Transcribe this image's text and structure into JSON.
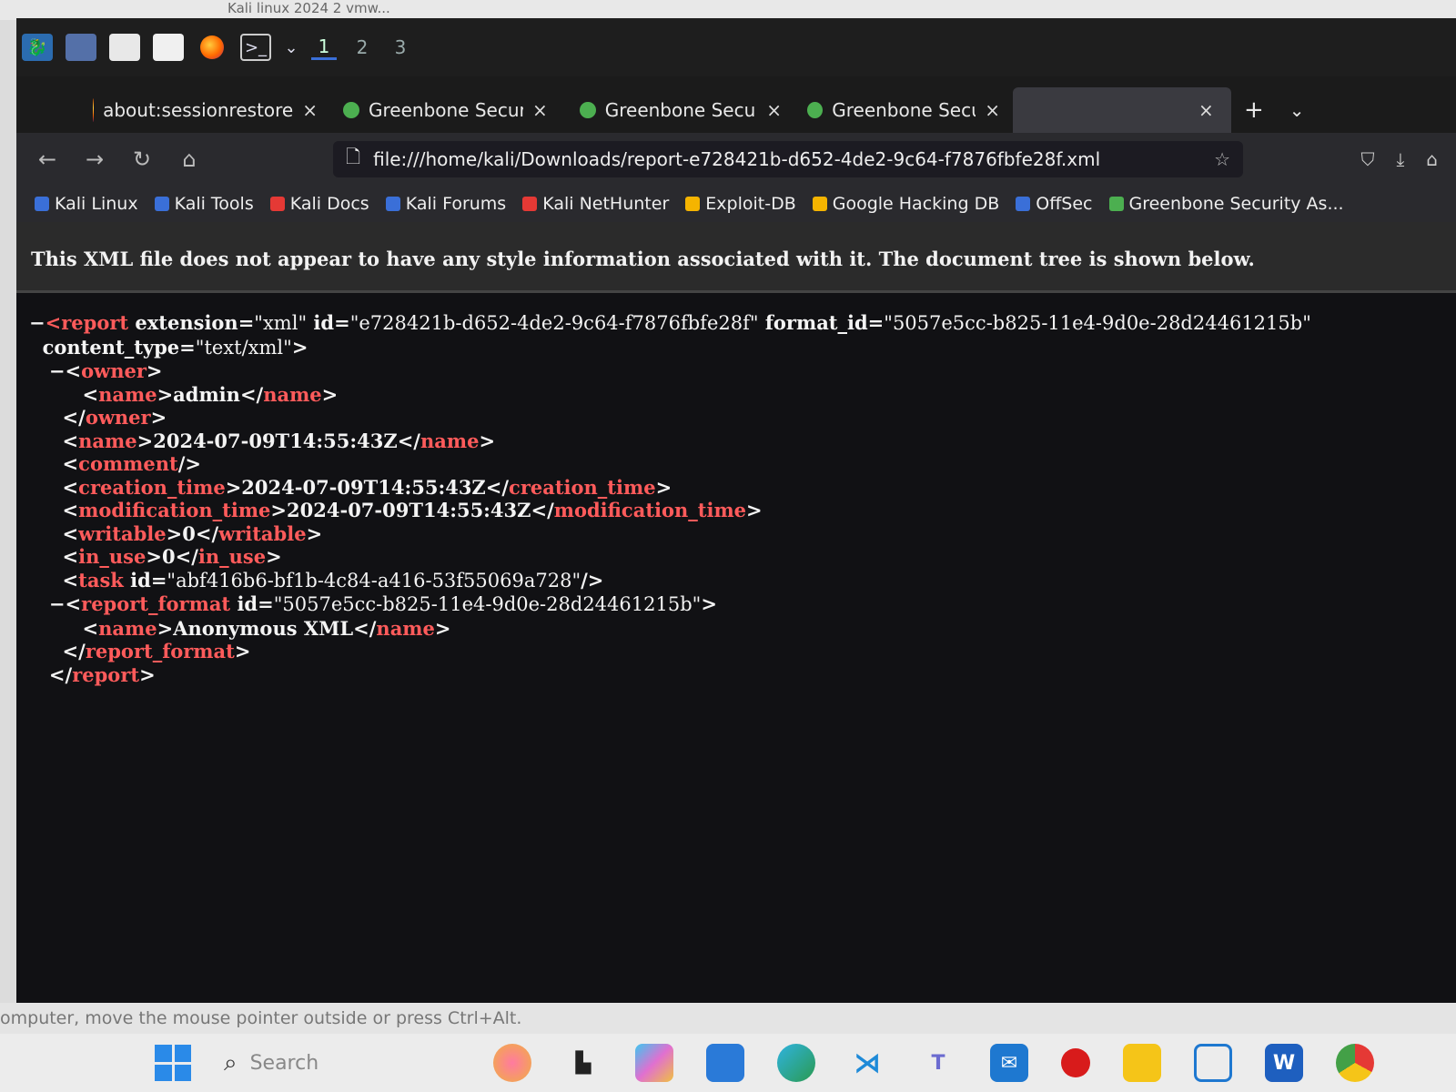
{
  "host": {
    "window_title": "Kali linux 2024 2 vmw...",
    "status_text": "omputer, move the mouse pointer outside or press Ctrl+Alt.",
    "search_placeholder": "Search"
  },
  "kali_panel": {
    "workspaces": [
      "1",
      "2",
      "3"
    ]
  },
  "browser": {
    "tabs": [
      {
        "label": "about:sessionrestore",
        "close": "×"
      },
      {
        "label": "Greenbone Security A",
        "close": "×"
      },
      {
        "label": "Greenbone Security A",
        "close": "×"
      },
      {
        "label": "Greenbone Security A",
        "close": "×"
      },
      {
        "label": "",
        "close": "×"
      }
    ],
    "new_tab": "+",
    "url": "file:///home/kali/Downloads/report-e728421b-d652-4de2-9c64-f7876fbfe28f.xml",
    "bookmarks": [
      {
        "label": "Kali Linux",
        "color": "#3a6fd8"
      },
      {
        "label": "Kali Tools",
        "color": "#3a6fd8"
      },
      {
        "label": "Kali Docs",
        "color": "#e53935"
      },
      {
        "label": "Kali Forums",
        "color": "#3a6fd8"
      },
      {
        "label": "Kali NetHunter",
        "color": "#e53935"
      },
      {
        "label": "Exploit-DB",
        "color": "#f5b400"
      },
      {
        "label": "Google Hacking DB",
        "color": "#f5b400"
      },
      {
        "label": "OffSec",
        "color": "#3a6fd8"
      },
      {
        "label": "Greenbone Security As...",
        "color": "#4caf50"
      }
    ]
  },
  "xml_view": {
    "notice": "This XML file does not appear to have any style information associated with it. The document tree is shown below.",
    "report_id": "e728421b-d652-4de2-9c64-f7876fbfe28f",
    "format_id": "5057e5cc-b825-11e4-9d0e-28d24461215b",
    "extension": "xml",
    "content_type": "text/xml",
    "owner_name": "admin",
    "name": "2024-07-09T14:55:43Z",
    "creation_time": "2024-07-09T14:55:43Z",
    "modification_time": "2024-07-09T14:55:43Z",
    "writable": "0",
    "in_use": "0",
    "task_id": "abf416b6-bf1b-4c84-a416-53f55069a728",
    "report_format_id": "5057e5cc-b825-11e4-9d0e-28d24461215b",
    "report_format_name": "Anonymous XML"
  }
}
